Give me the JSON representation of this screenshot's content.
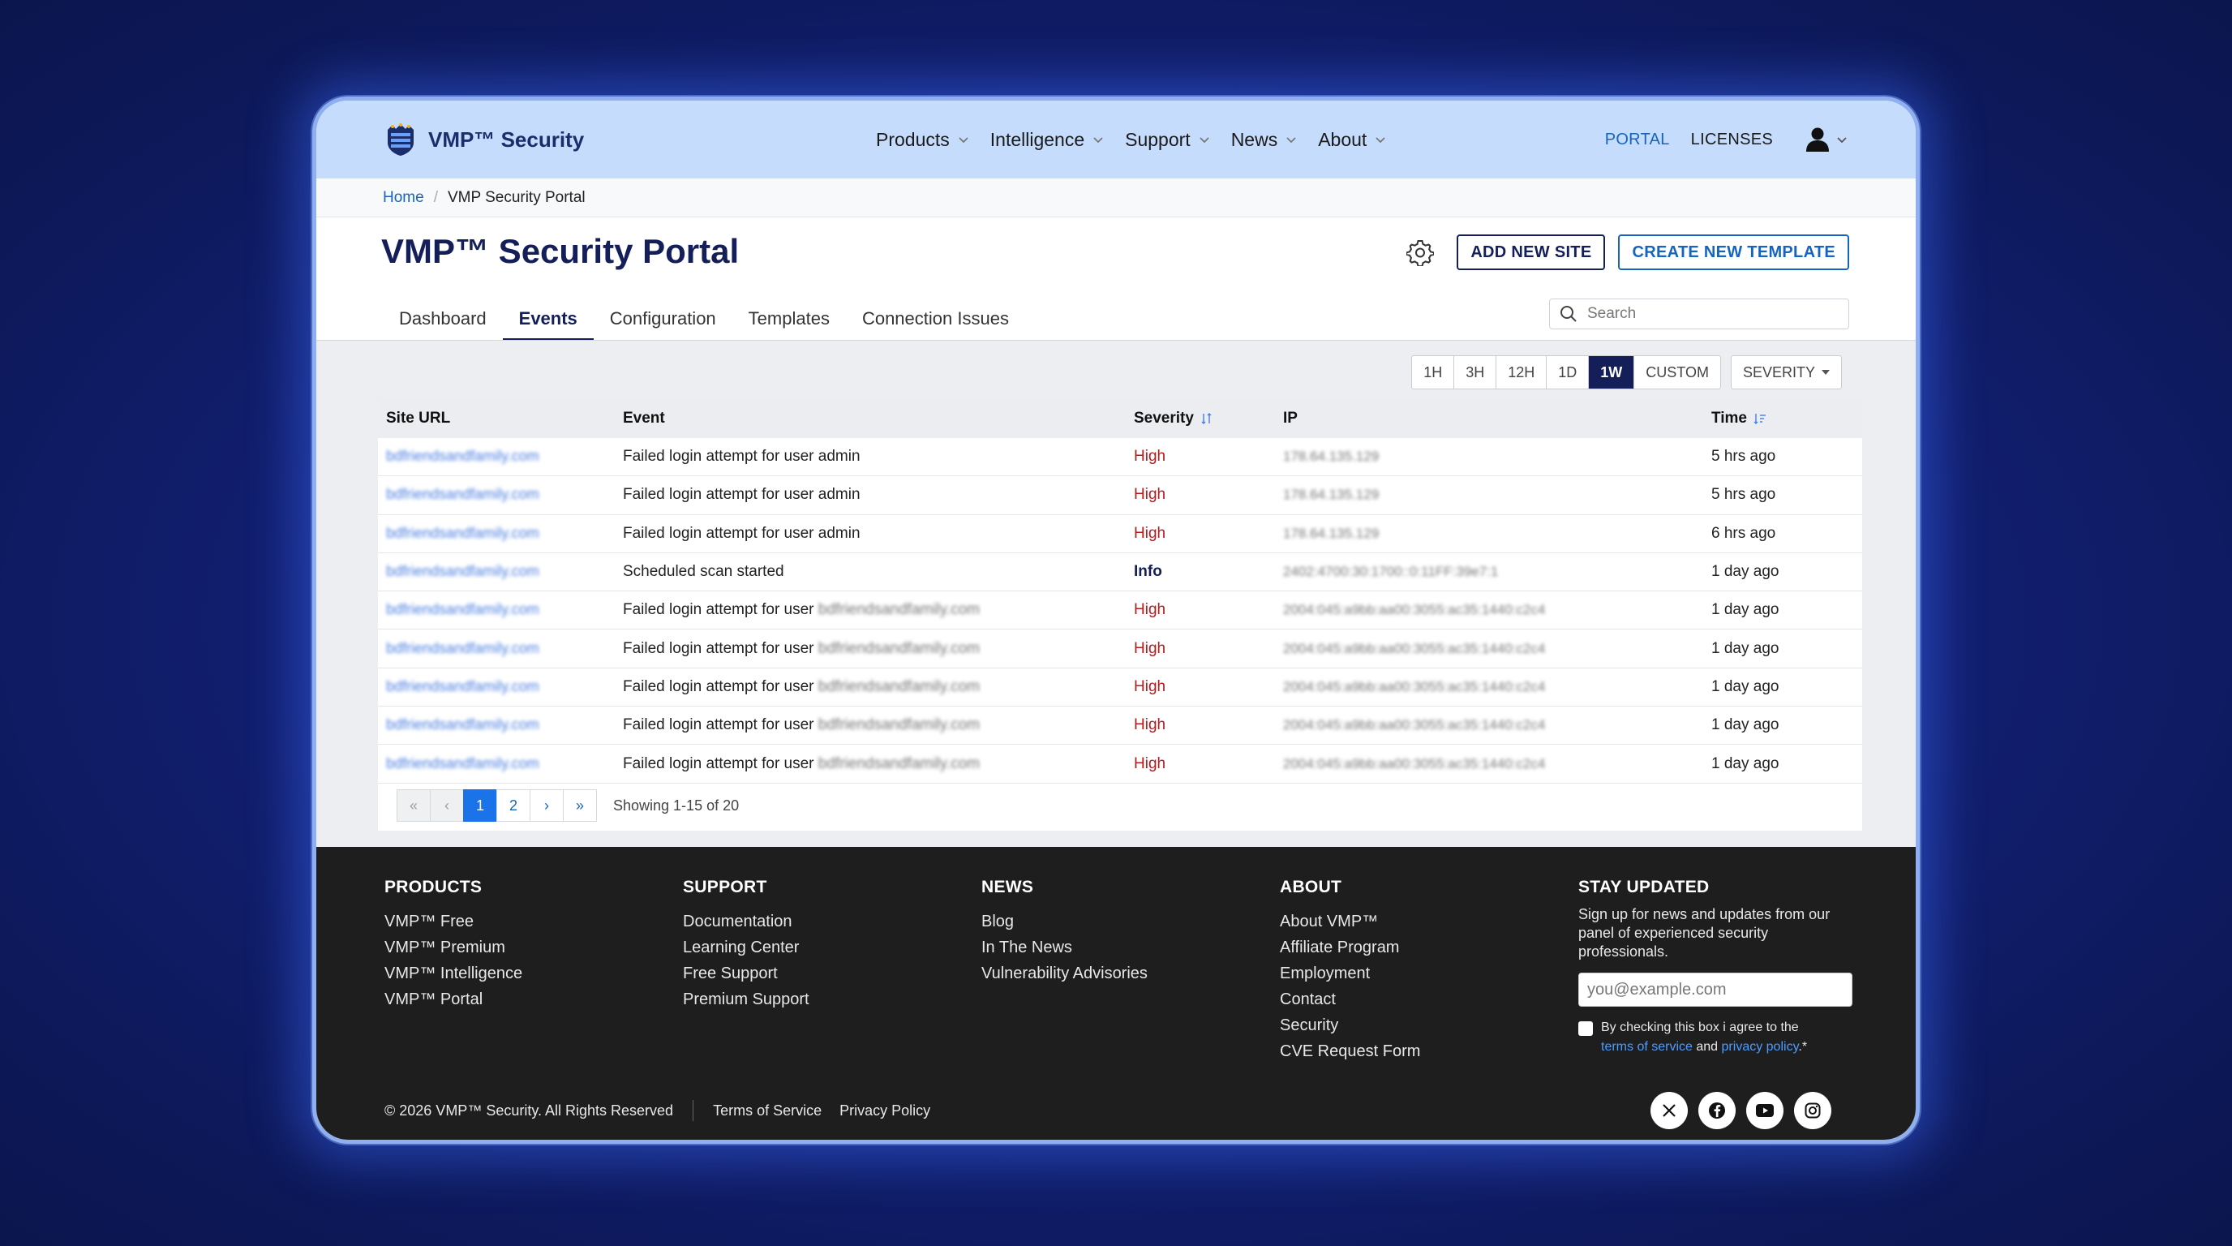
{
  "header": {
    "brand": "VMP™ Security",
    "nav": [
      "Products",
      "Intelligence",
      "Support",
      "News",
      "About"
    ],
    "portal": "PORTAL",
    "licenses": "LICENSES"
  },
  "breadcrumb": {
    "home": "Home",
    "sep": "/",
    "current": "VMP Security Portal"
  },
  "page": {
    "title": "VMP™ Security Portal",
    "add_site": "ADD NEW SITE",
    "create_template": "CREATE NEW TEMPLATE",
    "tabs": [
      "Dashboard",
      "Events",
      "Configuration",
      "Templates",
      "Connection Issues"
    ],
    "active_tab": "Events",
    "search_placeholder": "Search"
  },
  "filters": {
    "ranges": [
      "1H",
      "3H",
      "12H",
      "1D",
      "1W",
      "CUSTOM"
    ],
    "active_range": "1W",
    "severity": "SEVERITY"
  },
  "table": {
    "columns": [
      "Site URL",
      "Event",
      "Severity",
      "IP",
      "Time"
    ],
    "rows": [
      {
        "url": "bdfriendsandfamily.com",
        "event": "Failed login attempt for user admin",
        "user": "",
        "severity": "High",
        "ip": "178.64.135.129",
        "time": "5 hrs ago"
      },
      {
        "url": "bdfriendsandfamily.com",
        "event": "Failed login attempt for user admin",
        "user": "",
        "severity": "High",
        "ip": "178.64.135.129",
        "time": "5 hrs ago"
      },
      {
        "url": "bdfriendsandfamily.com",
        "event": "Failed login attempt for user admin",
        "user": "",
        "severity": "High",
        "ip": "178.64.135.129",
        "time": "6 hrs ago"
      },
      {
        "url": "bdfriendsandfamily.com",
        "event": "Scheduled scan started",
        "user": "",
        "severity": "Info",
        "ip": "2402:4700:30:1700::0:11FF:39e7:1",
        "time": "1 day ago"
      },
      {
        "url": "bdfriendsandfamily.com",
        "event": "Failed login attempt for user",
        "user": "bdfriendsandfamily.com",
        "severity": "High",
        "ip": "2004:045:a9bb:aa00:3055:ac35:1440:c2c4",
        "time": "1 day ago"
      },
      {
        "url": "bdfriendsandfamily.com",
        "event": "Failed login attempt for user",
        "user": "bdfriendsandfamily.com",
        "severity": "High",
        "ip": "2004:045:a9bb:aa00:3055:ac35:1440:c2c4",
        "time": "1 day ago"
      },
      {
        "url": "bdfriendsandfamily.com",
        "event": "Failed login attempt for user",
        "user": "bdfriendsandfamily.com",
        "severity": "High",
        "ip": "2004:045:a9bb:aa00:3055:ac35:1440:c2c4",
        "time": "1 day ago"
      },
      {
        "url": "bdfriendsandfamily.com",
        "event": "Failed login attempt for user",
        "user": "bdfriendsandfamily.com",
        "severity": "High",
        "ip": "2004:045:a9bb:aa00:3055:ac35:1440:c2c4",
        "time": "1 day ago"
      },
      {
        "url": "bdfriendsandfamily.com",
        "event": "Failed login attempt for user",
        "user": "bdfriendsandfamily.com",
        "severity": "High",
        "ip": "2004:045:a9bb:aa00:3055:ac35:1440:c2c4",
        "time": "1 day ago"
      }
    ]
  },
  "pagination": {
    "first": "«",
    "prev": "‹",
    "pages": [
      "1",
      "2"
    ],
    "next": "›",
    "last": "»",
    "active_page": "1",
    "showing": "Showing 1-15 of 20"
  },
  "footer": {
    "products": {
      "title": "PRODUCTS",
      "links": [
        "VMP™ Free",
        "VMP™ Premium",
        "VMP™ Intelligence",
        "VMP™ Portal"
      ]
    },
    "support": {
      "title": "SUPPORT",
      "links": [
        "Documentation",
        "Learning Center",
        "Free Support",
        "Premium Support"
      ]
    },
    "news": {
      "title": "NEWS",
      "links": [
        "Blog",
        "In The News",
        "Vulnerability Advisories"
      ]
    },
    "about": {
      "title": "ABOUT",
      "links": [
        "About VMP™",
        "Affiliate Program",
        "Employment",
        "Contact",
        "Security",
        "CVE Request Form"
      ]
    },
    "stay": {
      "title": "STAY UPDATED",
      "text": "Sign up for news and updates from our panel of experienced security professionals.",
      "email_placeholder": "you@example.com",
      "agree_prefix": "By checking this box i agree to the",
      "terms": "terms of service",
      "and": "and",
      "privacy": "privacy policy",
      "suffix": ".*"
    },
    "copyright": "© 2026 VMP™ Security. All Rights Reserved",
    "terms_link": "Terms of Service",
    "privacy_link": "Privacy Policy"
  },
  "colors": {
    "brand_navy": "#141f5a",
    "link_blue": "#1565c0",
    "high": "#b7191c",
    "header_bg": "#c5dcfc",
    "footer_bg": "#1e1e1e"
  },
  "icons": [
    "shield-logo-icon",
    "chevron-down-icon",
    "user-icon",
    "gear-icon",
    "search-icon",
    "sort-icon",
    "caret-down-icon",
    "x-social-icon",
    "facebook-icon",
    "youtube-icon",
    "instagram-icon"
  ]
}
